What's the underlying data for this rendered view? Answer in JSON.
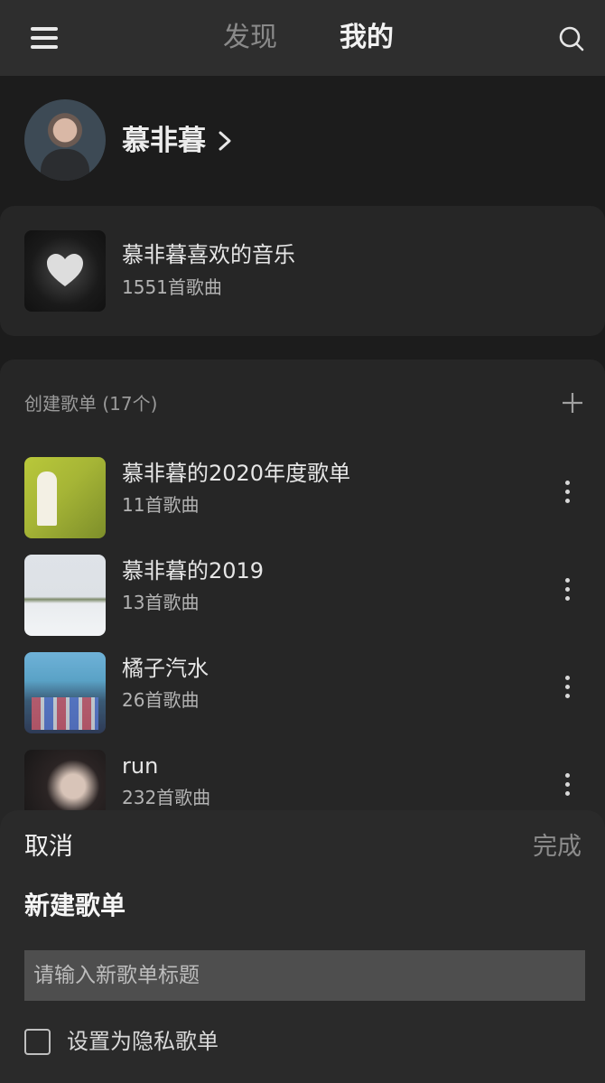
{
  "header": {
    "tabs": [
      {
        "label": "发现"
      },
      {
        "label": "我的"
      }
    ]
  },
  "profile": {
    "username": "慕非暮"
  },
  "liked": {
    "title": "慕非暮喜欢的音乐",
    "count": "1551首歌曲"
  },
  "created": {
    "header": "创建歌单 (17个)",
    "playlists": [
      {
        "title": "慕非暮的2020年度歌单",
        "count": "11首歌曲"
      },
      {
        "title": "慕非暮的2019",
        "count": "13首歌曲"
      },
      {
        "title": "橘子汽水",
        "count": "26首歌曲"
      },
      {
        "title": "run",
        "count": "232首歌曲"
      }
    ]
  },
  "sheet": {
    "cancel": "取消",
    "done": "完成",
    "title": "新建歌单",
    "input_placeholder": "请输入新歌单标题",
    "input_value": "",
    "private_label": "设置为隐私歌单",
    "private_checked": false
  },
  "icons": {
    "menu": "menu-icon",
    "search": "search-icon",
    "chevron": "chevron-right-icon",
    "add": "plus-icon",
    "more": "more-vertical-icon",
    "heart": "heart-icon"
  }
}
